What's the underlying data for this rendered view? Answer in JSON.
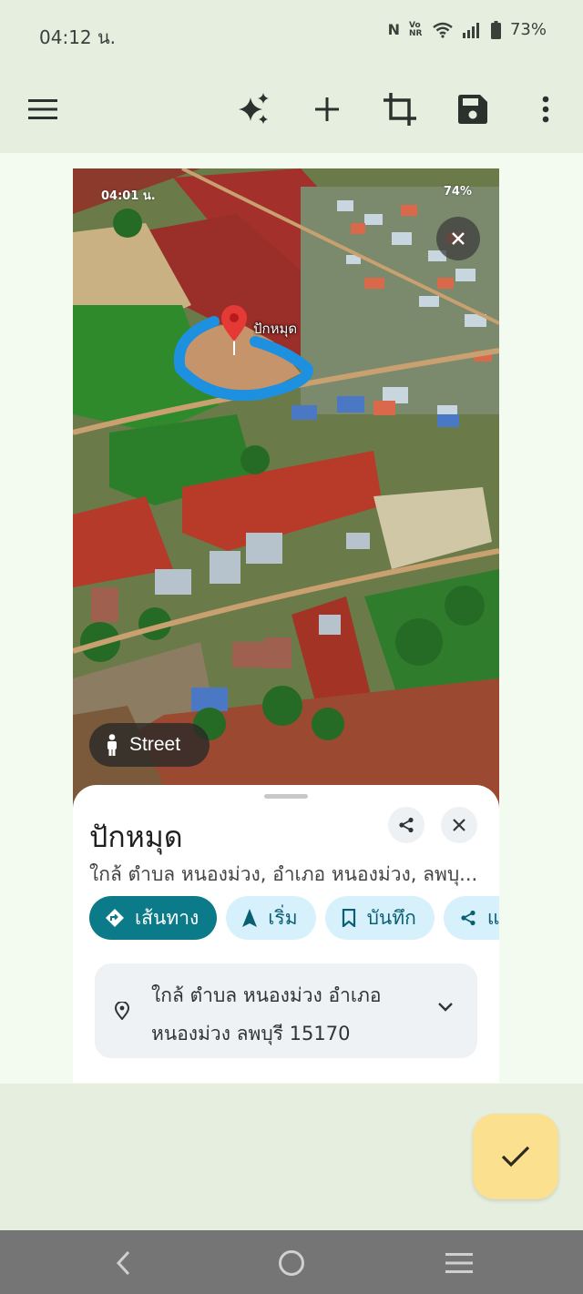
{
  "status_bar": {
    "time": "04:12 น.",
    "nfc": "N",
    "volte": "VoNR",
    "battery": "73%"
  },
  "toolbar": {
    "menu_icon": "hamburger-menu-icon",
    "sparkle_icon": "sparkle-icon",
    "add_icon": "plus-icon",
    "crop_icon": "crop-icon",
    "save_icon": "save-icon",
    "more_icon": "more-vertical-icon"
  },
  "screenshot": {
    "status_time": "04:01 น.",
    "status_battery": "74%",
    "pin_label": "ปักหมุด",
    "street_label": "Street",
    "place_title": "ปักหมุด",
    "place_subtitle": "ใกล้ ตำบล หนองม่วง, อำเภอ หนองม่วง, ลพบุ...",
    "chips": [
      {
        "label": "เส้นทาง",
        "icon": "directions-icon"
      },
      {
        "label": "เริ่ม",
        "icon": "navigation-arrow-icon"
      },
      {
        "label": "บันทึก",
        "icon": "bookmark-icon"
      },
      {
        "label": "แ",
        "icon": "share-icon"
      }
    ],
    "address_line1": "ใกล้ ตำบล หนองม่วง อำเภอ",
    "address_line2": "หนองม่วง ลพบุรี 15170"
  },
  "fab": {
    "icon": "checkmark-icon"
  },
  "colors": {
    "background": "#e6eedf",
    "primary_chip": "#0b7b8a",
    "secondary_chip": "#d6f1fb",
    "fab": "#fbe08f",
    "nav_bar": "#757575",
    "pin": "#e53935",
    "outline": "#1e90e0"
  }
}
